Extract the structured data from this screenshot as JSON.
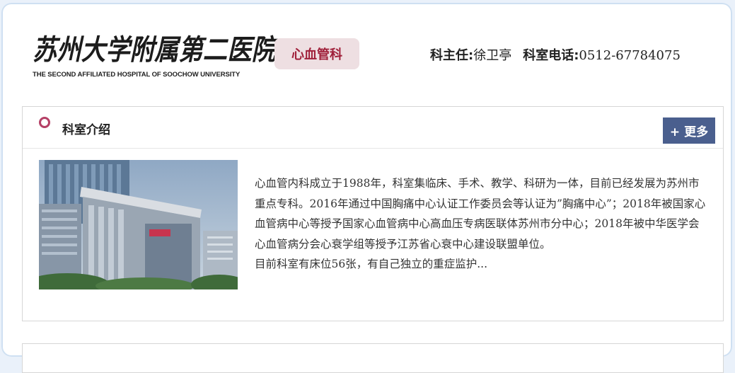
{
  "header": {
    "logo_cn": "苏州大学附属第二医院",
    "logo_en": "THE SECOND AFFILIATED HOSPITAL OF SOOCHOW UNIVERSITY",
    "department": "心血管科",
    "director_label": "科主任:",
    "director_name": "徐卫亭",
    "phone_label": "科室电话:",
    "phone": "0512-67784075"
  },
  "intro_section": {
    "title": "科室介绍",
    "more_label": "+ 更多",
    "paragraph1": "心血管内科成立于1988年，科室集临床、手术、教学、科研为一体，目前已经发展为苏州市重点专科。2016年通过中国胸痛中心认证工作委员会等认证为”胸痛中心”；2018年被国家心血管病中心等授予国家心血管病中心高血压专病医联体苏州市分中心；2018年被中华医学会心血管病分会心衰学组等授予江苏省心衰中心建设联盟单位。",
    "paragraph2": "目前科室有床位56张，有自己独立的重症监护..."
  },
  "colors": {
    "accent_pink": "#b54066",
    "department_text": "#a0203a",
    "more_button_bg": "#4a5f8e",
    "page_bg": "#eaf1fa"
  },
  "icons": {
    "section_marker": "ring-icon"
  }
}
